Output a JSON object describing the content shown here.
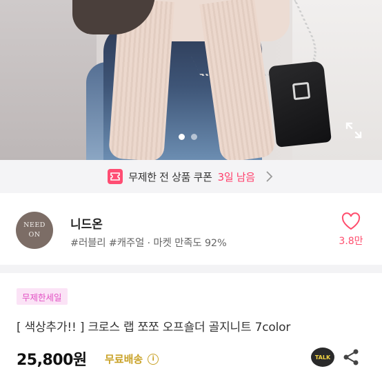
{
  "gallery": {
    "dot_count": 2,
    "active_index": 0
  },
  "coupon_banner": {
    "icon": "coupon-icon",
    "text": "무제한 전 상품 쿠폰",
    "accent": "3일 남음",
    "accent_color": "#ff3d6a"
  },
  "shop": {
    "logo_line1": "NEED",
    "logo_line2": "ON",
    "name": "니드온",
    "meta": "#러블리 #캐주얼 · 마켓 만족도 92%",
    "like_count": "3.8만",
    "like_color": "#ff4d6d"
  },
  "product": {
    "badge": "무제한세일",
    "title": "[ 색상추가!! ] 크로스 랩 쪼쪼 오프숄더 골지니트 7color",
    "price": "25,800원",
    "shipping": "무료배송",
    "shipping_color": "#c9a227",
    "talk_label": "TALK"
  }
}
